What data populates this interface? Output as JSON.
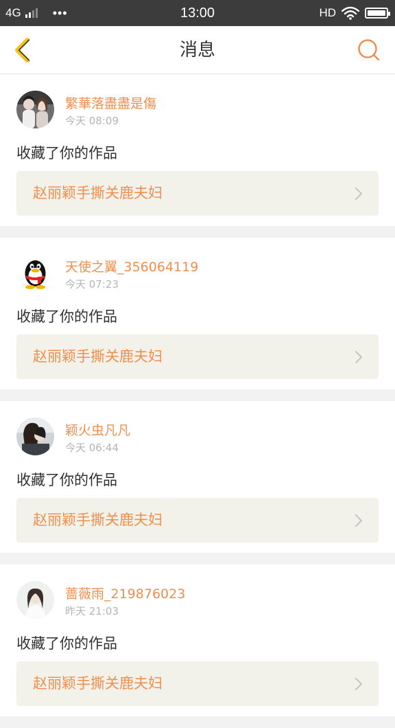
{
  "status_bar": {
    "network": "4G",
    "more": "•••",
    "time": "13:00",
    "hd": "HD",
    "battery_level": 1.0
  },
  "header": {
    "title": "消息"
  },
  "messages": [
    {
      "username": "繁華落盡盡是傷",
      "time": "今天 08:09",
      "action": "收藏了你的作品",
      "work_title": "赵丽颖手撕关鹿夫妇"
    },
    {
      "username": "天使之翼_356064119",
      "time": "今天 07:23",
      "action": "收藏了你的作品",
      "work_title": "赵丽颖手撕关鹿夫妇"
    },
    {
      "username": "颖火虫凡凡",
      "time": "今天 06:44",
      "action": "收藏了你的作品",
      "work_title": "赵丽颖手撕关鹿夫妇"
    },
    {
      "username": "蔷薇雨_219876023",
      "time": "昨天 21:03",
      "action": "收藏了你的作品",
      "work_title": "赵丽颖手撕关鹿夫妇"
    }
  ],
  "colors": {
    "accent": "#ef8f4f",
    "back_icon": "#f2c21b",
    "status_bar": "#3c3c3c"
  }
}
